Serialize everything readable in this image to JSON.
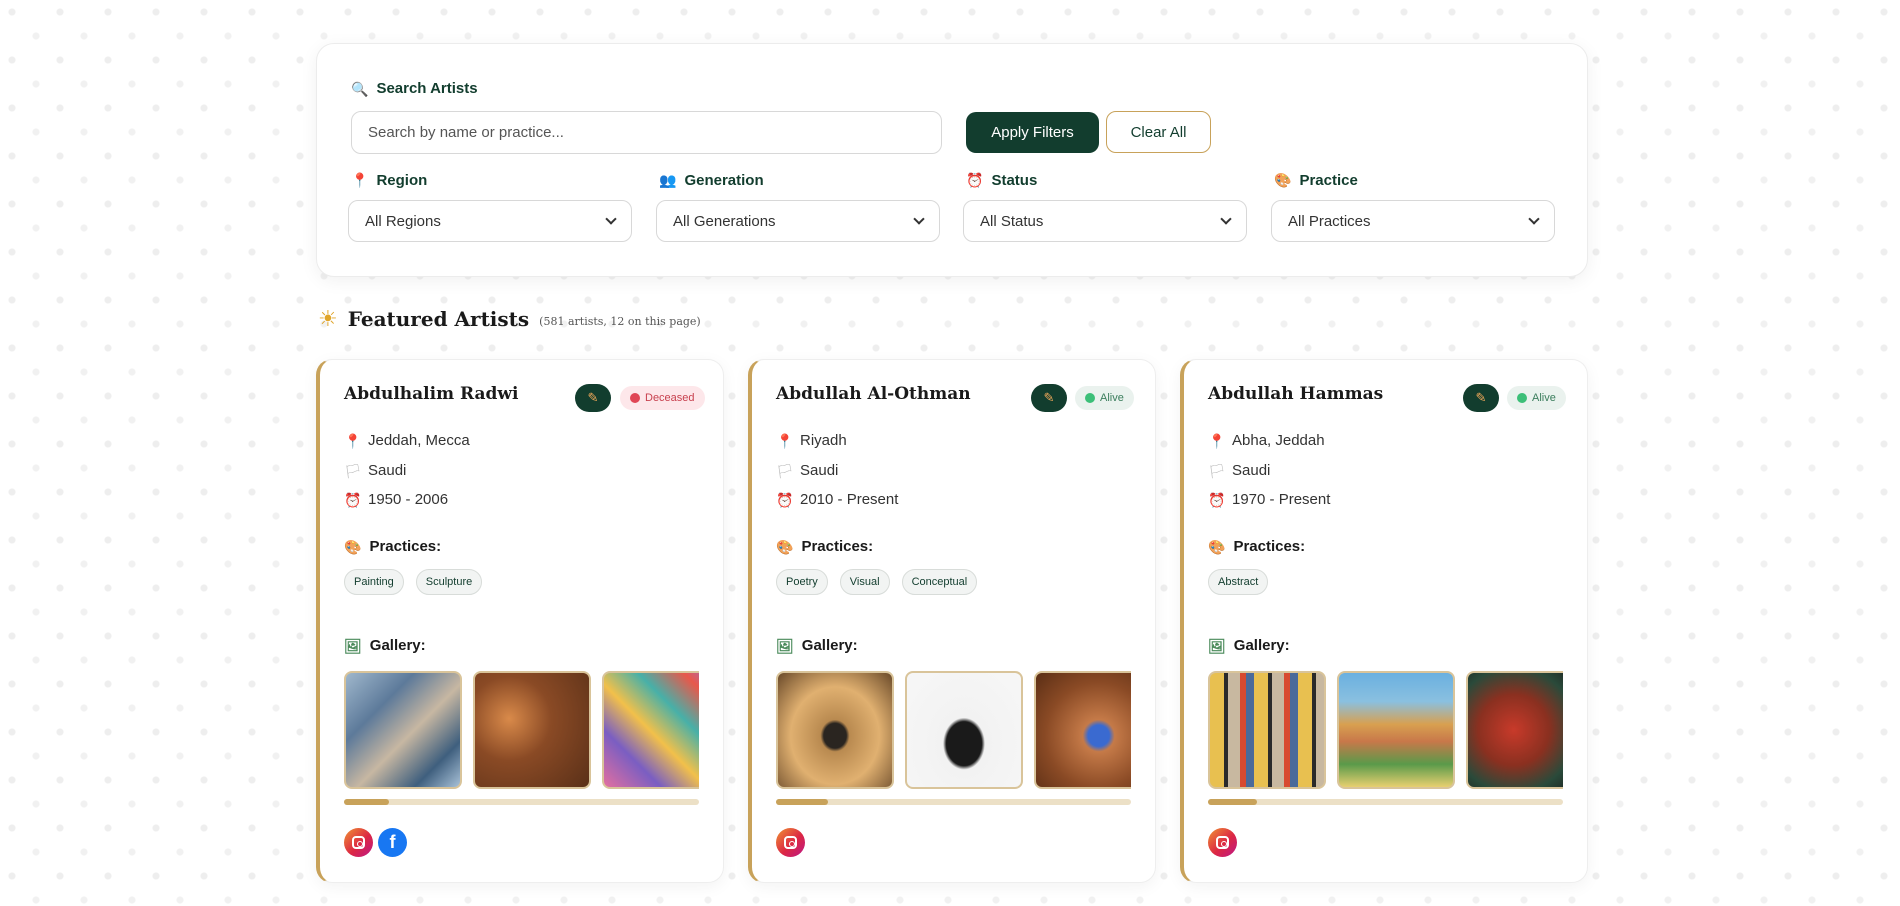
{
  "filters": {
    "search_label": "Search Artists",
    "search_placeholder": "Search by name or practice...",
    "search_value": "",
    "apply_label": "Apply Filters",
    "clear_label": "Clear All",
    "groups": [
      {
        "label": "Region",
        "icon": "pin-icon",
        "value": "All Regions"
      },
      {
        "label": "Generation",
        "icon": "people-icon",
        "value": "All Generations"
      },
      {
        "label": "Status",
        "icon": "alarm-clock-icon",
        "value": "All Status"
      },
      {
        "label": "Practice",
        "icon": "palette-icon",
        "value": "All Practices"
      }
    ]
  },
  "section": {
    "title": "Featured Artists",
    "subtitle": "(581 artists, 12 on this page)"
  },
  "labels": {
    "practices": "Practices:",
    "gallery": "Gallery:"
  },
  "colors": {
    "primary": "#123d2e",
    "accent": "#c8a25a",
    "deceased": "#e04555",
    "alive": "#3cbf78"
  },
  "artists": [
    {
      "name": "Abdulhalim Radwi",
      "status": "Deceased",
      "location": "Jeddah, Mecca",
      "nationality": "Saudi",
      "years": "1950 - 2006",
      "practices": [
        "Painting",
        "Sculpture"
      ],
      "gallery": [
        "artwork-city-collage",
        "artwork-figures-brown",
        "artwork-abstract-colorful"
      ],
      "gallery_scroll_fraction": 0.15,
      "socials": [
        "instagram",
        "facebook"
      ]
    },
    {
      "name": "Abdullah Al-Othman",
      "status": "Alive",
      "location": "Riyadh",
      "nationality": "Saudi",
      "years": "2010 - Present",
      "practices": [
        "Poetry",
        "Visual",
        "Conceptual"
      ],
      "gallery": [
        "photo-man-in-cave",
        "photo-portrait-seated",
        "photo-desert-aerial"
      ],
      "gallery_scroll_fraction": 0.15,
      "socials": [
        "instagram"
      ]
    },
    {
      "name": "Abdullah Hammas",
      "status": "Alive",
      "location": "Abha, Jeddah",
      "nationality": "Saudi",
      "years": "1970 - Present",
      "practices": [
        "Abstract"
      ],
      "gallery": [
        "artwork-geometric-stripes",
        "artwork-village-houses",
        "artwork-red-patterns"
      ],
      "gallery_scroll_fraction": 0.14,
      "socials": [
        "instagram"
      ]
    }
  ]
}
